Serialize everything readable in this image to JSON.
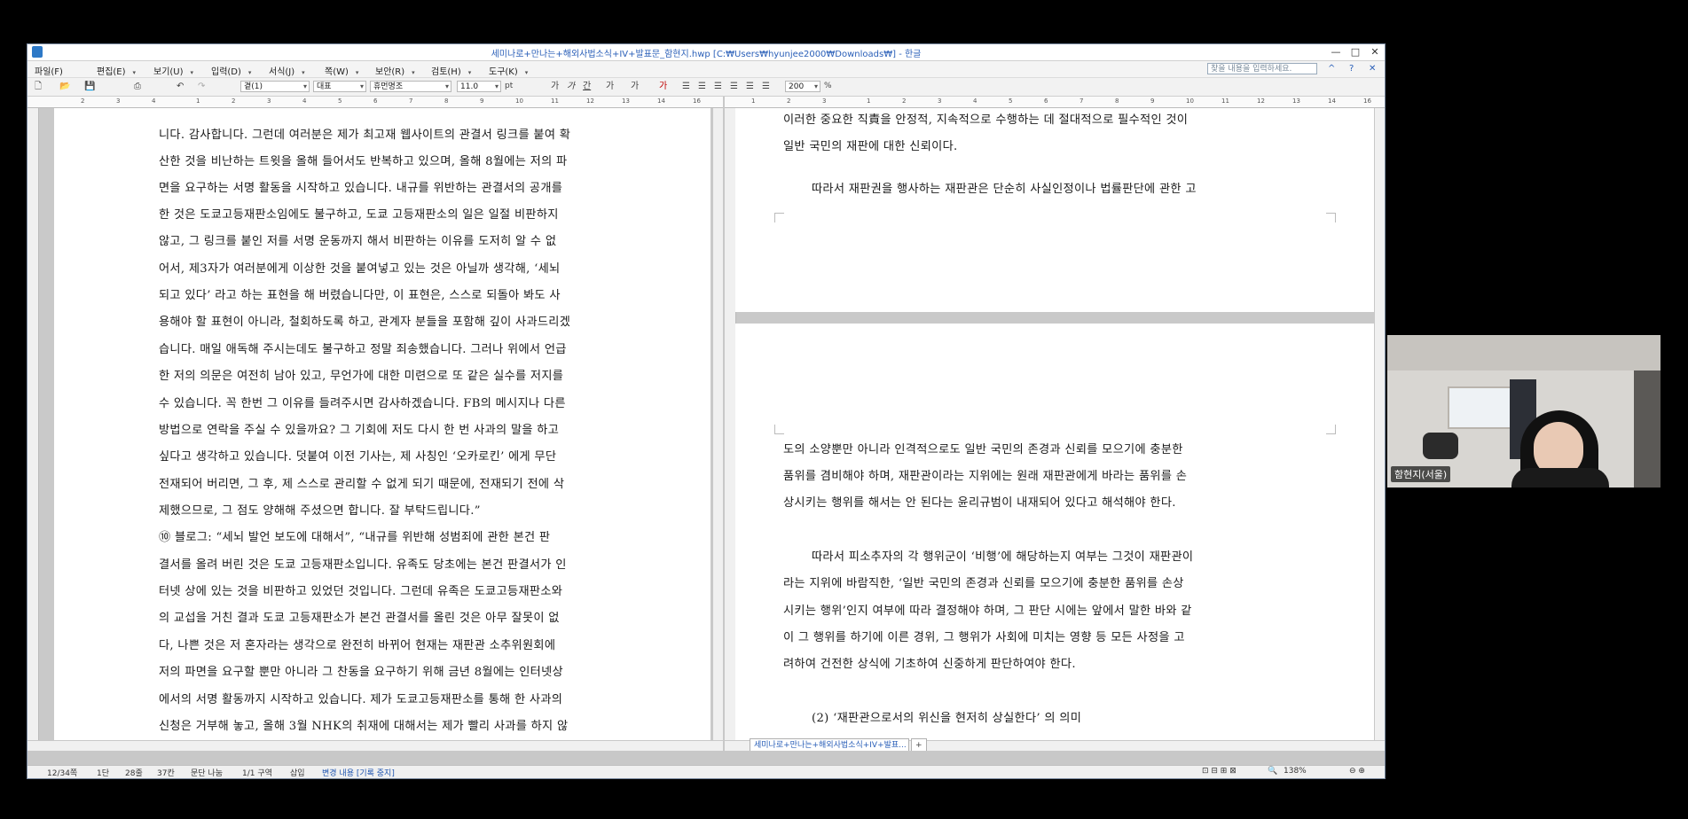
{
  "window": {
    "title": "세미나로+만나는+해외사법소식+IV+발표문_함현지.hwp [C:₩Users₩hyunjee2000₩Downloads₩] - 한글",
    "controls": [
      "—",
      "□",
      "✕"
    ]
  },
  "menubar": {
    "items": [
      "파일(F)",
      "편집(E)",
      "보기(U)",
      "입력(D)",
      "서식(J)",
      "쪽(W)",
      "보안(R)",
      "검토(H)",
      "도구(K)"
    ],
    "find_placeholder": "찾을 내용을 입력하세요.",
    "right_icons": [
      "^",
      "?",
      "✕"
    ]
  },
  "toolbar": {
    "style_combo": "곁(1)",
    "font_type_combo": "대표",
    "font_combo": "휴먼명조",
    "size_value": "11.0",
    "size_unit": "pt",
    "char_buttons": [
      "가",
      "가",
      "간",
      "가",
      "가",
      "가"
    ],
    "zoom_value": "200",
    "zoom_unit": "%"
  },
  "left_page": {
    "lines": [
      "니다. 감사합니다. 그런데 여러분은 제가 최고재 웹사이트의 관결서 링크를 붙여 확",
      "산한 것을 비난하는 트윗을 올해 들어서도 반복하고 있으며, 올해 8월에는 저의 파",
      "면을 요구하는 서명 활동을 시작하고 있습니다. 내규를 위반하는 관결서의 공개를",
      "한 것은 도쿄고등재판소임에도 불구하고, 도쿄 고등재판소의 일은 일절 비판하지",
      "않고, 그 링크를 붙인 저를 서명 운동까지 해서 비판하는 이유를 도저히 알 수 없",
      "어서, 제3자가 여러분에게 이상한 것을 붙여넣고 있는 것은 아닐까 생각해, ‘세뇌",
      "되고 있다’ 라고 하는 표현을 해 버렸습니다만, 이 표현은, 스스로 되돌아 봐도 사",
      "용해야 할 표현이 아니라, 철회하도록 하고, 관계자 분들을 포함해 깊이 사과드리겠",
      "습니다. 매일 애독해 주시는데도 불구하고 정말 죄송했습니다. 그러나 위에서 언급",
      "한 저의 의문은 여전히 남아 있고, 무언가에 대한 미련으로 또 같은 실수를 저지를",
      "수 있습니다. 꼭 한번 그 이유를 들려주시면 감사하겠습니다. FB의 메시지나 다른",
      "방법으로 연락을 주실 수 있을까요? 그 기회에 저도 다시 한 번 사과의 말을 하고",
      "싶다고 생각하고 있습니다. 덧붙여 이전 기사는, 제 사칭인 ‘오카로킨’ 에게 무단",
      "전재되어 버리면, 그 후, 제 스스로 관리할 수 없게 되기 때문에, 전재되기 전에 삭",
      "제했으므로, 그 점도 양해해 주셨으면 합니다. 잘 부탁드립니다.”",
      "⑩ 블로그: “세뇌 발언 보도에 대해서”, “내규를 위반해 성범죄에 관한 본건 판",
      "결서를 올려 버린 것은 도쿄 고등재판소입니다. 유족도 당초에는 본건 판결서가 인",
      "터넷 상에 있는 것을 비판하고 있었던 것입니다. 그런데 유족은 도쿄고등재판소와",
      "의 교섭을 거친 결과 도쿄 고등재판소가 본건 관결서를 올린 것은 아무 잘못이 없",
      "다, 나쁜 것은 저 혼자라는 생각으로 완전히 바뀌어 현재는 재판관 소추위원회에",
      "저의 파면을 요구할 뿐만 아니라 그 찬동을 요구하기 위해 금년 8월에는 인터넷상",
      "에서의 서명 활동까지 시작하고 있습니다. 제가 도쿄고등재판소를 통해 한 사과의",
      "신청은 거부해 놓고, 올해 3월 NHK의 취재에 대해서는 제가 빨리 사과를 하지 않"
    ]
  },
  "right_top_page": {
    "lines": [
      "이러한 중요한 직責을 안정적, 지속적으로 수행하는 데 절대적으로 필수적인 것이",
      "일반 국민의 재판에 대한 신뢰이다.",
      "따라서 재판권을 행사하는 재판관은 단순히 사실인정이나 법률판단에 관한 고"
    ]
  },
  "right_bottom_page": {
    "lines": [
      "도의 소양뿐만 아니라 인격적으로도 일반 국민의 존경과 신뢰를 모으기에 충분한",
      "품위를 겸비해야 하며, 재판관이라는 지위에는 원래 재판관에게 바라는 품위를 손",
      "상시키는 행위를 해서는 안 된다는 윤리규범이 내재되어 있다고 해석해야 한다.",
      "따라서 피소추자의 각 행위군이 ‘비행’에 해당하는지 여부는 그것이 재판관이",
      "라는 지위에 바람직한, ‘일반 국민의 존경과 신뢰를 모으기에 충분한 품위를 손상",
      "시키는 행위’인지 여부에 따라 결정해야 하며, 그 판단 시에는 앞에서 말한 바와 같",
      "이 그 행위를 하기에 이른 경위, 그 행위가 사회에 미치는 영향 등 모든 사정을 고",
      "려하여 건전한 상식에 기초하여 신중하게 판단하여야 한다.",
      "(2) ‘재판관으로서의 위신을 현저히 상실한다’ 의 의미"
    ]
  },
  "statusbar": {
    "page": "12/34쪽",
    "column": "1단",
    "line": "28줄",
    "char": "37칸",
    "split": "문단 나눔",
    "section": "1/1 구역",
    "mode": "삽입",
    "track": "변경 내용 [기록 중지]",
    "zoom": "138%"
  },
  "doc_tab": {
    "label": "세미나로+만나는+해외사법소식+IV+발표..."
  },
  "webcam": {
    "label": "함현지(서울)"
  },
  "colors": {
    "title_blue": "#2a5fb8",
    "status_blue": "#1f55b0"
  }
}
